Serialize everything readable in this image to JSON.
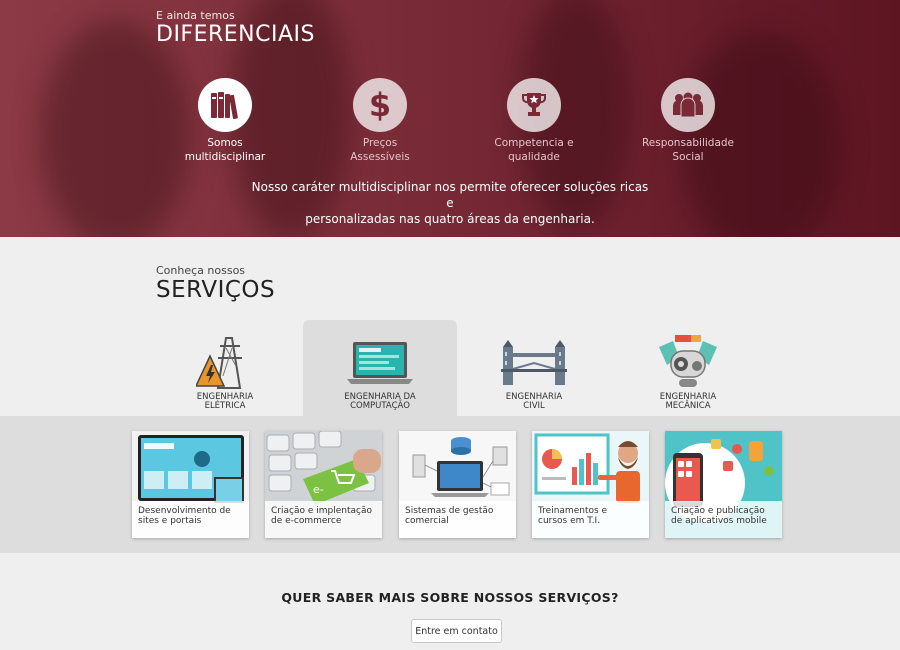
{
  "hero": {
    "subtitle": "E ainda temos",
    "title": "DIFERENCIAIS",
    "items": [
      {
        "label_line1": "Somos",
        "label_line2": "multidisciplinar",
        "icon": "books-icon",
        "active": true
      },
      {
        "label_line1": "Preços",
        "label_line2": "Assessíveis",
        "icon": "dollar-icon",
        "active": false
      },
      {
        "label_line1": "Competencia e",
        "label_line2": "qualidade",
        "icon": "trophy-icon",
        "active": false
      },
      {
        "label_line1": "Responsabilidade",
        "label_line2": "Social",
        "icon": "people-icon",
        "active": false
      }
    ],
    "description_line1": "Nosso caráter multidisciplinar nos permite oferecer soluções ricas e",
    "description_line2": "personalizadas nas quatro áreas da engenharia.",
    "colors": {
      "accent": "#7a2a36",
      "active_icon": "#7a2a36"
    }
  },
  "services": {
    "subtitle": "Conheça nossos",
    "title": "SERVIÇOS",
    "tabs": [
      {
        "line1": "ENGENHARIA",
        "line2": "ELÉTRICA",
        "icon": "power-tower-icon",
        "active": false
      },
      {
        "line1": "ENGENHARIA DA",
        "line2": "COMPUTAÇÃO",
        "icon": "laptop-icon",
        "active": true
      },
      {
        "line1": "ENGENHARIA",
        "line2": "CIVIL",
        "icon": "bridge-icon",
        "active": false
      },
      {
        "line1": "ENGENHARIA",
        "line2": "MECÂNICA",
        "icon": "robot-arm-icon",
        "active": false
      }
    ],
    "cards": [
      {
        "line1": "Desenvolvimento de",
        "line2": "sites e portais"
      },
      {
        "line1": "Criação e implentação",
        "line2": "de e-commerce"
      },
      {
        "line1": "Sistemas de gestão",
        "line2": "comercial"
      },
      {
        "line1": "Treinamentos e",
        "line2": "cursos em T.I."
      },
      {
        "line1": "Criação e publicação",
        "line2": "de aplicativos mobile"
      }
    ]
  },
  "cta": {
    "title": "QUER SABER MAIS SOBRE NOSSOS SERVIÇOS?",
    "button_label": "Entre em contato"
  }
}
